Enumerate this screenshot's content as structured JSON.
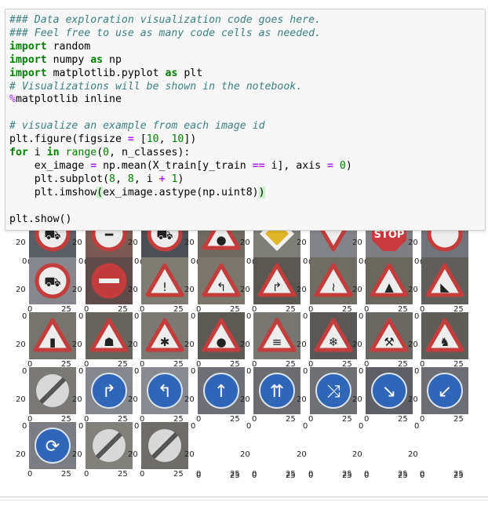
{
  "code_lines": [
    "### Data exploration visualization code goes here.",
    "### Feel free to use as many code cells as needed.",
    "import random",
    "import numpy as np",
    "import matplotlib.pyplot as plt",
    "# Visualizations will be shown in the notebook.",
    "%matplotlib inline",
    "",
    "# visualize an example from each image id",
    "plt.figure(figsize = [10, 10])",
    "for i in range(0, n_classes):",
    "    ex_image = np.mean(X_train[y_train == i], axis = 0)",
    "    plt.subplot(8, 8, i + 1)",
    "    plt.imshow(ex_image.astype(np.uint8))",
    "",
    "plt.show()"
  ],
  "tick_labels": {
    "zero": "0",
    "twenty": "20",
    "twentyfive": "25"
  },
  "signs": [
    {
      "shape": "circle-red",
      "glyph": "⛟",
      "bg": "#5a5f66"
    },
    {
      "shape": "circle-red",
      "glyph": "━",
      "bg": "#7a5a54"
    },
    {
      "shape": "circle-red",
      "glyph": "⛟",
      "bg": "#4c4f55"
    },
    {
      "shape": "triangle-red",
      "glyph": "●",
      "bg": "#6e6a62"
    },
    {
      "shape": "diamond-yellow",
      "glyph": "",
      "bg": "#7d7f78"
    },
    {
      "shape": "tri-down-red",
      "glyph": "",
      "bg": "#82848a"
    },
    {
      "shape": "stop",
      "glyph": "STOP",
      "bg": "#7f7f83"
    },
    {
      "shape": "circle-red",
      "glyph": "",
      "bg": "#707379"
    },
    {
      "shape": "circle-red",
      "glyph": "⛟",
      "bg": "#86878c"
    },
    {
      "shape": "no-entry",
      "glyph": "",
      "bg": "#5e4a48"
    },
    {
      "shape": "triangle-red",
      "glyph": "!",
      "bg": "#7f7c74"
    },
    {
      "shape": "triangle-red",
      "glyph": "↰",
      "bg": "#7a766c"
    },
    {
      "shape": "triangle-red",
      "glyph": "↱",
      "bg": "#5a5752"
    },
    {
      "shape": "triangle-red",
      "glyph": "≀",
      "bg": "#6f6c64"
    },
    {
      "shape": "triangle-red",
      "glyph": "▲",
      "bg": "#6a675e"
    },
    {
      "shape": "triangle-red",
      "glyph": "◣",
      "bg": "#5f5e5b"
    },
    {
      "shape": "triangle-red",
      "glyph": "▮",
      "bg": "#75736e"
    },
    {
      "shape": "triangle-red",
      "glyph": "☗",
      "bg": "#66645d"
    },
    {
      "shape": "triangle-red",
      "glyph": "✱",
      "bg": "#7a7973"
    },
    {
      "shape": "triangle-red",
      "glyph": "●",
      "bg": "#5c5a55"
    },
    {
      "shape": "triangle-red",
      "glyph": "≡",
      "bg": "#787670"
    },
    {
      "shape": "triangle-red",
      "glyph": "❄",
      "bg": "#5a5856"
    },
    {
      "shape": "triangle-red",
      "glyph": "⚒",
      "bg": "#6a6862"
    },
    {
      "shape": "triangle-red",
      "glyph": "♞",
      "bg": "#5f5d58"
    },
    {
      "shape": "end",
      "glyph": "",
      "bg": "#7a7976"
    },
    {
      "shape": "blue",
      "glyph": "↱",
      "bg": "#86878c"
    },
    {
      "shape": "blue",
      "glyph": "↰",
      "bg": "#8a8b90"
    },
    {
      "shape": "blue",
      "glyph": "↑",
      "bg": "#6e7076"
    },
    {
      "shape": "blue",
      "glyph": "⇈",
      "bg": "#6c6c70"
    },
    {
      "shape": "blue",
      "glyph": "⤨",
      "bg": "#6f7074"
    },
    {
      "shape": "blue",
      "glyph": "↘",
      "bg": "#5e6066"
    },
    {
      "shape": "blue",
      "glyph": "↙",
      "bg": "#6c6e74"
    },
    {
      "shape": "blue",
      "glyph": "⟳",
      "bg": "#7b7d82"
    },
    {
      "shape": "end",
      "glyph": "",
      "bg": "#82807a"
    },
    {
      "shape": "end",
      "glyph": "",
      "bg": "#6e6c68"
    }
  ]
}
